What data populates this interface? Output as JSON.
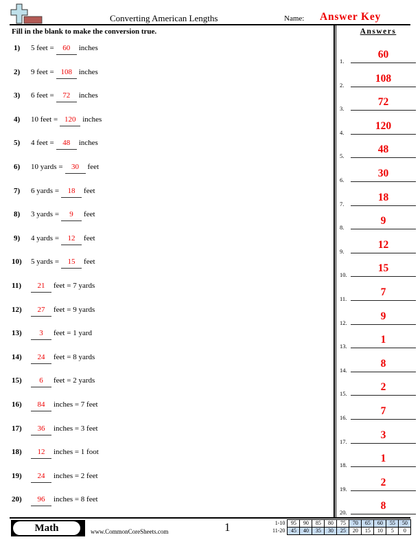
{
  "header": {
    "title": "Converting American Lengths",
    "name_label": "Name:",
    "name_value": "Answer Key",
    "logo_icon": "plus-ruler-logo"
  },
  "instructions": "Fill in the blank to make the conversion true.",
  "questions": [
    {
      "num": "1)",
      "pre": "5 feet =",
      "answer": "60",
      "post": "inches"
    },
    {
      "num": "2)",
      "pre": "9 feet =",
      "answer": "108",
      "post": "inches"
    },
    {
      "num": "3)",
      "pre": "6 feet =",
      "answer": "72",
      "post": "inches"
    },
    {
      "num": "4)",
      "pre": "10 feet =",
      "answer": "120",
      "post": "inches"
    },
    {
      "num": "5)",
      "pre": "4 feet =",
      "answer": "48",
      "post": "inches"
    },
    {
      "num": "6)",
      "pre": "10 yards =",
      "answer": "30",
      "post": "feet"
    },
    {
      "num": "7)",
      "pre": "6 yards =",
      "answer": "18",
      "post": "feet"
    },
    {
      "num": "8)",
      "pre": "3 yards =",
      "answer": "9",
      "post": "feet"
    },
    {
      "num": "9)",
      "pre": "4 yards =",
      "answer": "12",
      "post": "feet"
    },
    {
      "num": "10)",
      "pre": "5 yards =",
      "answer": "15",
      "post": "feet"
    },
    {
      "num": "11)",
      "pre": "",
      "answer": "21",
      "post": "feet = 7 yards"
    },
    {
      "num": "12)",
      "pre": "",
      "answer": "27",
      "post": "feet = 9 yards"
    },
    {
      "num": "13)",
      "pre": "",
      "answer": "3",
      "post": "feet = 1 yard"
    },
    {
      "num": "14)",
      "pre": "",
      "answer": "24",
      "post": "feet = 8 yards"
    },
    {
      "num": "15)",
      "pre": "",
      "answer": "6",
      "post": "feet = 2 yards"
    },
    {
      "num": "16)",
      "pre": "",
      "answer": "84",
      "post": "inches = 7 feet"
    },
    {
      "num": "17)",
      "pre": "",
      "answer": "36",
      "post": "inches = 3 feet"
    },
    {
      "num": "18)",
      "pre": "",
      "answer": "12",
      "post": "inches = 1 foot"
    },
    {
      "num": "19)",
      "pre": "",
      "answer": "24",
      "post": "inches = 2 feet"
    },
    {
      "num": "20)",
      "pre": "",
      "answer": "96",
      "post": "inches = 8 feet"
    }
  ],
  "answers_panel": {
    "heading": "Answers",
    "items": [
      {
        "n": "1.",
        "v": "60"
      },
      {
        "n": "2.",
        "v": "108"
      },
      {
        "n": "3.",
        "v": "72"
      },
      {
        "n": "4.",
        "v": "120"
      },
      {
        "n": "5.",
        "v": "48"
      },
      {
        "n": "6.",
        "v": "30"
      },
      {
        "n": "7.",
        "v": "18"
      },
      {
        "n": "8.",
        "v": "9"
      },
      {
        "n": "9.",
        "v": "12"
      },
      {
        "n": "10.",
        "v": "15"
      },
      {
        "n": "11.",
        "v": "7"
      },
      {
        "n": "12.",
        "v": "9"
      },
      {
        "n": "13.",
        "v": "1"
      },
      {
        "n": "14.",
        "v": "8"
      },
      {
        "n": "15.",
        "v": "2"
      },
      {
        "n": "16.",
        "v": "7"
      },
      {
        "n": "17.",
        "v": "3"
      },
      {
        "n": "18.",
        "v": "1"
      },
      {
        "n": "19.",
        "v": "2"
      },
      {
        "n": "20.",
        "v": "8"
      }
    ]
  },
  "footer": {
    "subject": "Math",
    "website": "www.CommonCoreSheets.com",
    "page_number": "1",
    "score_table": {
      "rows": [
        {
          "label": "1-10",
          "values": [
            "95",
            "90",
            "85",
            "80",
            "75",
            "70",
            "65",
            "60",
            "55",
            "50"
          ],
          "highlight": [
            false,
            false,
            false,
            false,
            false,
            true,
            true,
            true,
            true,
            true
          ]
        },
        {
          "label": "11-20",
          "values": [
            "45",
            "40",
            "35",
            "30",
            "25",
            "20",
            "15",
            "10",
            "5",
            "0"
          ],
          "highlight": [
            true,
            true,
            true,
            true,
            true,
            false,
            false,
            false,
            false,
            false
          ]
        }
      ]
    }
  }
}
